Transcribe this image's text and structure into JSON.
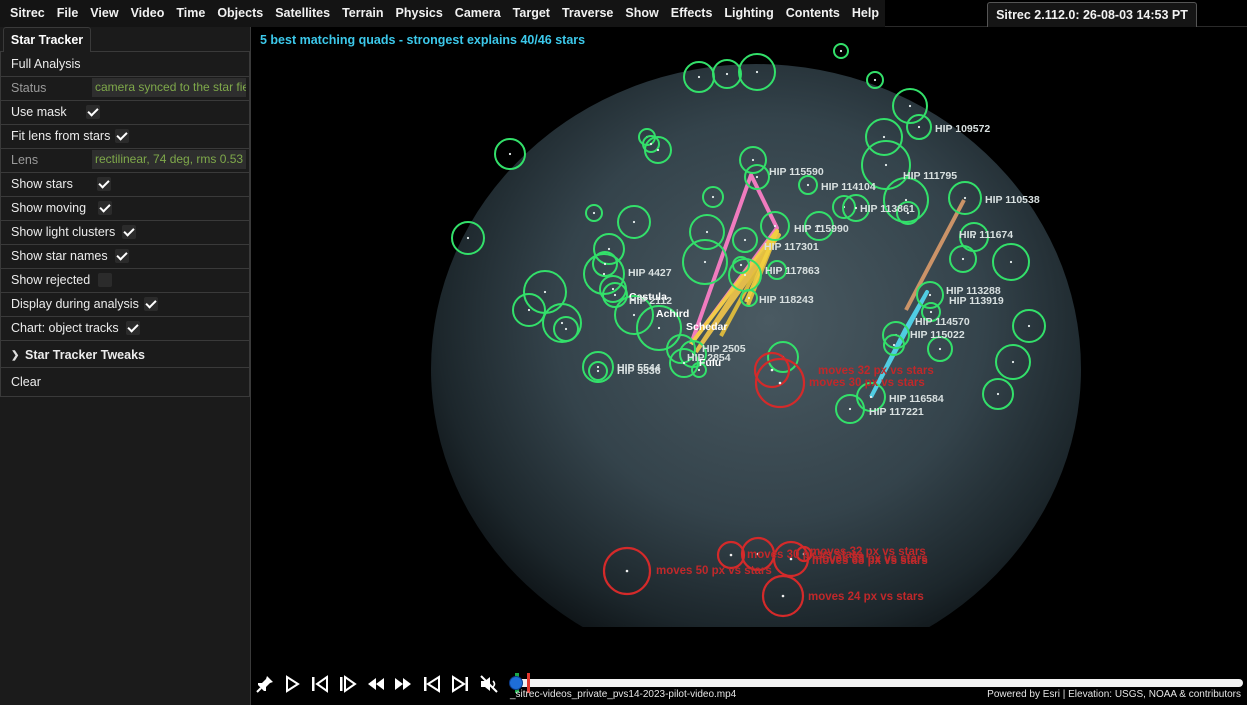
{
  "menu": {
    "items": [
      "Sitrec",
      "File",
      "View",
      "Video",
      "Time",
      "Objects",
      "Satellites",
      "Terrain",
      "Physics",
      "Camera",
      "Target",
      "Traverse",
      "Show",
      "Effects",
      "Lighting",
      "Contents",
      "Help"
    ]
  },
  "version": "Sitrec 2.112.0: 26-08-03 14:53 PT",
  "panel": {
    "tab": "Star Tracker",
    "full_analysis": "Full Analysis",
    "status_label": "Status",
    "status_value": "camera synced to the star field",
    "use_mask": {
      "label": "Use mask",
      "checked": true
    },
    "fit_lens": {
      "label": "Fit lens from stars",
      "checked": true
    },
    "lens_label": "Lens",
    "lens_value": "rectilinear, 74 deg, rms 0.53",
    "show_stars": {
      "label": "Show stars",
      "checked": true
    },
    "show_moving": {
      "label": "Show moving",
      "checked": true
    },
    "show_light_clusters": {
      "label": "Show light clusters",
      "checked": true
    },
    "show_star_names": {
      "label": "Show star names",
      "checked": true
    },
    "show_rejected": {
      "label": "Show rejected",
      "checked": false
    },
    "display_during_analysis": {
      "label": "Display during analysis",
      "checked": true
    },
    "chart_object_tracks": {
      "label": "Chart: object tracks",
      "checked": true
    },
    "tweaks": "Star Tracker Tweaks",
    "clear": "Clear"
  },
  "video": {
    "caption": "5 best matching quads - strongest explains 40/46 stars",
    "colors": {
      "matched": "#33e06a",
      "moving": "#d42a2a",
      "caption": "#3cc8ea"
    },
    "star_labels": [
      "HIP 109572",
      "HIP 115590",
      "HIP 114104",
      "HIP 111795",
      "HIP 110538",
      "HIP 113861",
      "HIP 115990",
      "HIP 111674",
      "HIP 117301",
      "HIP 4427",
      "HIP 117863",
      "Castula",
      "HIP 2112",
      "HIP 113288",
      "HIP 113919",
      "HIP 118243",
      "Achird",
      "HIP 114570",
      "Schedar",
      "HIP 115022",
      "HIP 2505",
      "HIP 2854",
      "Fulu",
      "HIP 5544",
      "HIP 5536",
      "HIP 116584",
      "HIP 117221"
    ],
    "moving_labels": [
      "moves 32 px vs stars",
      "moves 30 px vs stars",
      "moves 33 px vs stars",
      "moves 68 px vs stars",
      "moves 50 px vs stars",
      "moves 24 px vs stars",
      "moves 32 px vs stars",
      "moves 30 px vs stars"
    ]
  },
  "playback": {
    "progress": 0.01,
    "file": "_sitrec-videos_private_pvs14-2023-pilot-video.mp4",
    "attribution": "Powered by Esri | Elevation: USGS, NOAA & contributors"
  }
}
